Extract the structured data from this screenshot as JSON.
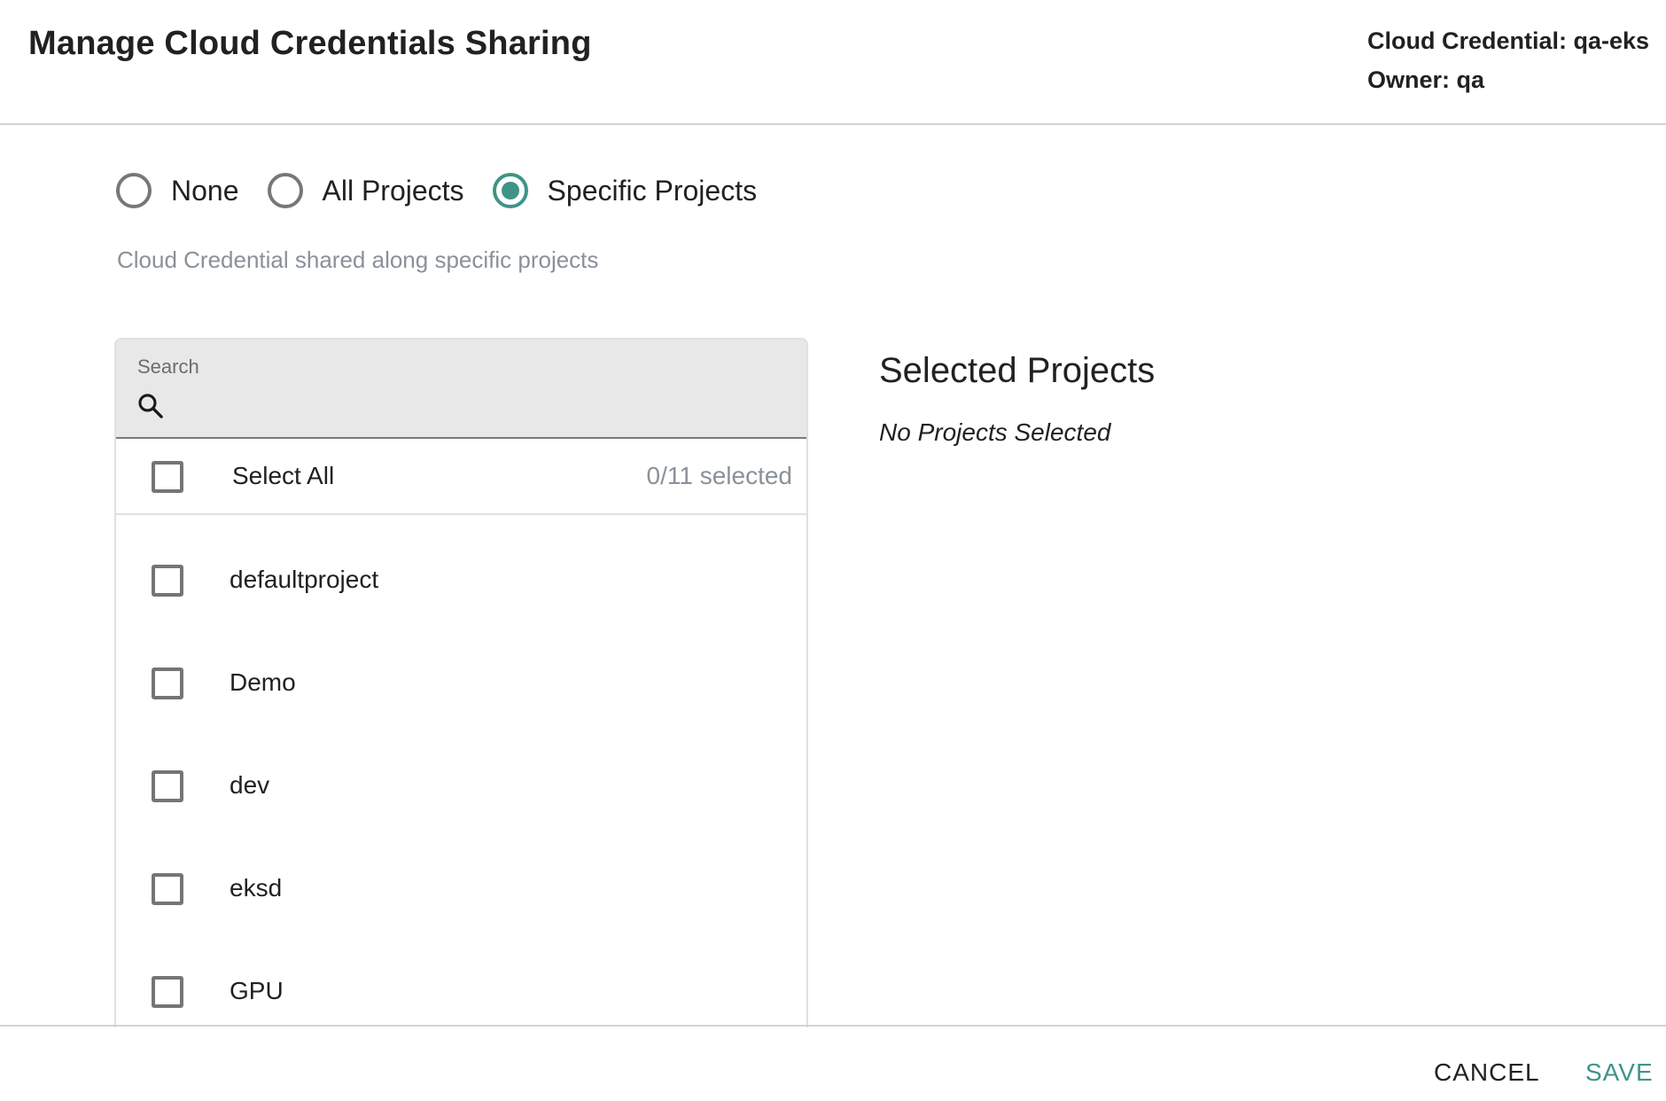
{
  "header": {
    "title": "Manage Cloud Credentials Sharing",
    "credential_line": "Cloud Credential: qa-eks",
    "owner_line": "Owner: qa"
  },
  "sharing": {
    "options": [
      {
        "label": "None",
        "checked": false
      },
      {
        "label": "All Projects",
        "checked": false
      },
      {
        "label": "Specific Projects",
        "checked": true
      }
    ],
    "description": "Cloud Credential shared along specific projects"
  },
  "project_list": {
    "search": {
      "label": "Search",
      "value": "",
      "placeholder": ""
    },
    "select_all_label": "Select All",
    "selected_count": "0/11 selected",
    "items": [
      {
        "label": "defaultproject",
        "checked": false
      },
      {
        "label": "Demo",
        "checked": false
      },
      {
        "label": "dev",
        "checked": false
      },
      {
        "label": "eksd",
        "checked": false
      },
      {
        "label": "GPU",
        "checked": false
      }
    ]
  },
  "selected_projects": {
    "title": "Selected Projects",
    "empty_message": "No Projects Selected"
  },
  "footer": {
    "cancel_label": "CANCEL",
    "save_label": "SAVE"
  },
  "colors": {
    "accent": "#3f9487",
    "muted_text": "#8a9199"
  }
}
